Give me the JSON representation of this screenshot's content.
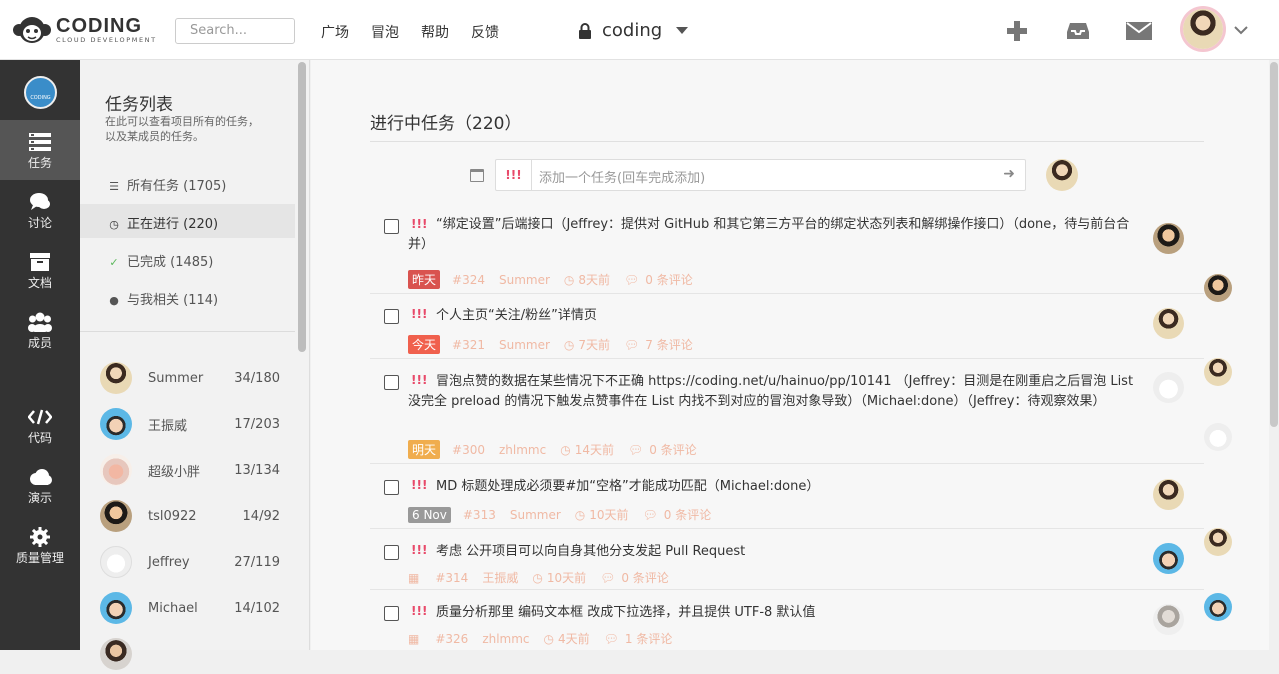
{
  "header": {
    "logo_text": "CODING",
    "logo_sub": "CLOUD DEVELOPMENT",
    "search_placeholder": "Search...",
    "nav": [
      "广场",
      "冒泡",
      "帮助",
      "反馈"
    ],
    "project": "coding"
  },
  "leftnav": {
    "logo_text": "CODING",
    "items": [
      {
        "label": "任务",
        "icon": "tasks-icon"
      },
      {
        "label": "讨论",
        "icon": "chat-icon"
      },
      {
        "label": "文档",
        "icon": "archive-icon"
      },
      {
        "label": "成员",
        "icon": "members-icon"
      },
      {
        "label": "代码",
        "icon": "code-icon"
      },
      {
        "label": "演示",
        "icon": "cloud-icon"
      },
      {
        "label": "质量管理",
        "icon": "gear-icon"
      }
    ]
  },
  "sidebar": {
    "title": "任务列表",
    "desc": "在此可以查看项目所有的任务，以及某成员的任务。",
    "filters": [
      {
        "label": "所有任务 (1705)"
      },
      {
        "label": "正在进行 (220)"
      },
      {
        "label": "已完成 (1485)"
      },
      {
        "label": "与我相关 (114)"
      }
    ],
    "members": [
      {
        "name": "Summer",
        "count": "34/180"
      },
      {
        "name": "王振威",
        "count": "17/203"
      },
      {
        "name": "超级小胖",
        "count": "13/134"
      },
      {
        "name": "tsl0922",
        "count": "14/92"
      },
      {
        "name": "Jeffrey",
        "count": "27/119"
      },
      {
        "name": "Michael",
        "count": "14/102"
      }
    ]
  },
  "main": {
    "title": "进行中任务（220）",
    "add_placeholder": "添加一个任务(回车完成添加)",
    "priority_mark": "!!!",
    "tasks": [
      {
        "text": "“绑定设置”后端接口（Jeffrey：提供对 GitHub 和其它第三方平台的绑定状态列表和解绑操作接口）（done，待与前台合并）",
        "tag": "昨天",
        "tag_color": "#d9534f",
        "num": "#324",
        "owner": "Summer",
        "time": "8天前",
        "comments": "0 条评论"
      },
      {
        "text": "个人主页“关注/粉丝”详情页",
        "tag": "今天",
        "tag_color": "#f0604d",
        "num": "#321",
        "owner": "Summer",
        "time": "7天前",
        "comments": "7 条评论"
      },
      {
        "text": "冒泡点赞的数据在某些情况下不正确 https://coding.net/u/hainuo/pp/10141 （Jeffrey：目测是在刚重启之后冒泡 List 没完全 preload 的情况下触发点赞事件在 List 内找不到对应的冒泡对象导致）（Michael:done）（Jeffrey：待观察效果）",
        "tag": "明天",
        "tag_color": "#f0ad4e",
        "num": "#300",
        "owner": "zhlmmc",
        "time": "14天前",
        "comments": "0 条评论"
      },
      {
        "text": "MD 标题处理成必须要#加“空格”才能成功匹配（Michael:done）",
        "tag": "6 Nov",
        "tag_color": "#999999",
        "num": "#313",
        "owner": "Summer",
        "time": "10天前",
        "comments": "0 条评论"
      },
      {
        "text": "考虑 公开项目可以向自身其他分支发起 Pull Request",
        "tag": "",
        "tag_color": "",
        "num": "#314",
        "owner": "王振威",
        "time": "10天前",
        "comments": "0 条评论"
      },
      {
        "text": "质量分析那里 编码文本框 改成下拉选择，并且提供 UTF-8 默认值",
        "tag": "",
        "tag_color": "",
        "num": "#326",
        "owner": "zhlmmc",
        "time": "4天前",
        "comments": "1 条评论"
      }
    ]
  }
}
